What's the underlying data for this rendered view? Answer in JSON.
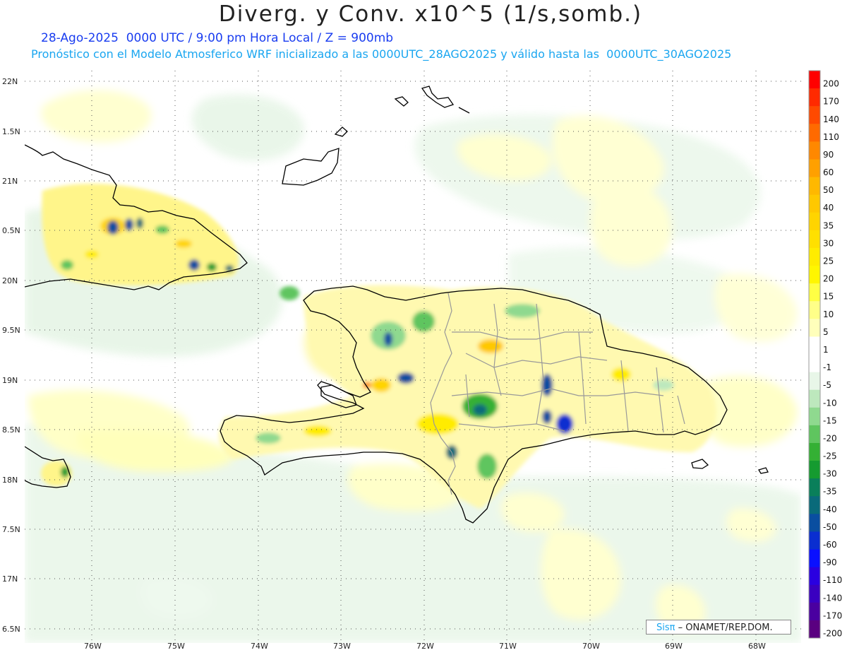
{
  "title": "Diverg. y Conv. x10^5 (1/s,somb.)",
  "subtitle_1": "28-Ago-2025  0000 UTC / 9:00 pm Hora Local / Z = 900mb",
  "subtitle_2": "Pronóstico con el Modelo Atmosferico WRF inicializado a las 0000UTC_28AGO2025 y válido hasta las  0000UTC_30AGO2025",
  "lat_labels": [
    "22N",
    "1.5N",
    "21N",
    "0.5N",
    "20N",
    "9.5N",
    "19N",
    "8.5N",
    "18N",
    "7.5N",
    "17N",
    "6.5N"
  ],
  "lon_labels": [
    "76W",
    "75W",
    "74W",
    "73W",
    "72W",
    "71W",
    "70W",
    "69W",
    "68W"
  ],
  "colorbar_labels": [
    "200",
    "170",
    "140",
    "110",
    "90",
    "60",
    "50",
    "40",
    "35",
    "30",
    "25",
    "20",
    "15",
    "10",
    "5",
    "1",
    "-1",
    "-5",
    "-10",
    "-15",
    "-20",
    "-25",
    "-30",
    "-35",
    "-40",
    "-50",
    "-60",
    "-90",
    "-110",
    "-140",
    "-170",
    "-200"
  ],
  "colorbar_colors": [
    "#ff0000",
    "#ff2a00",
    "#ff4a00",
    "#ff6a00",
    "#ff8800",
    "#ffa000",
    "#ffb800",
    "#ffc800",
    "#ffd400",
    "#ffe000",
    "#ffec00",
    "#fff600",
    "#ffff44",
    "#ffff88",
    "#ffffbb",
    "#ffffff",
    "#ffffff",
    "#e8f6e8",
    "#bde8bd",
    "#8fd98f",
    "#5fc55f",
    "#34b034",
    "#159b30",
    "#0a7f5a",
    "#0a6a7a",
    "#0a4ea0",
    "#0a2ed0",
    "#0a10ff",
    "#2a00e0",
    "#3a00c0",
    "#4a00a0",
    "#5a0080"
  ],
  "credit_sis": "Sisπ",
  "credit_org": " – ONAMET/REP.DOM."
}
